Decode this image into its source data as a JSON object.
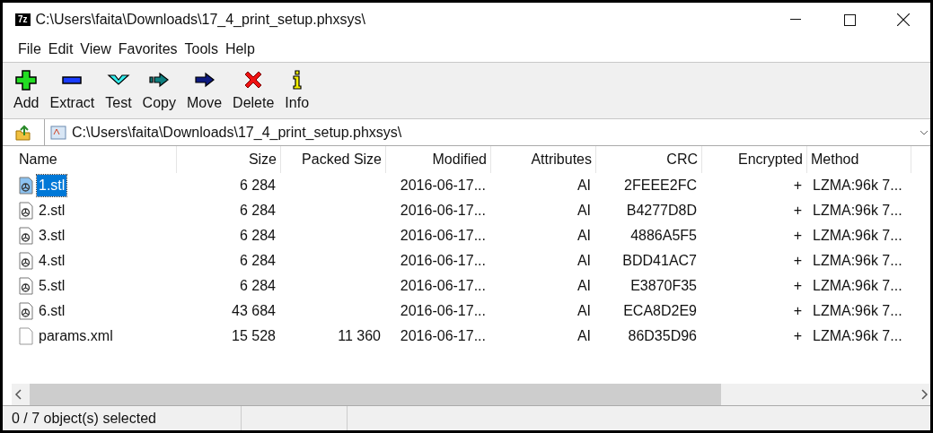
{
  "window": {
    "logo": "7z",
    "title": "C:\\Users\\faita\\Downloads\\17_4_print_setup.phxsys\\"
  },
  "menu": [
    "File",
    "Edit",
    "View",
    "Favorites",
    "Tools",
    "Help"
  ],
  "toolbar": [
    {
      "kind": "add",
      "label": "Add"
    },
    {
      "kind": "extract",
      "label": "Extract"
    },
    {
      "kind": "test",
      "label": "Test"
    },
    {
      "kind": "copy",
      "label": "Copy"
    },
    {
      "kind": "move",
      "label": "Move"
    },
    {
      "kind": "delete",
      "label": "Delete"
    },
    {
      "kind": "info",
      "label": "Info"
    }
  ],
  "address": {
    "value": "C:\\Users\\faita\\Downloads\\17_4_print_setup.phxsys\\"
  },
  "table": {
    "columns": [
      "Name",
      "Size",
      "Packed Size",
      "Modified",
      "Attributes",
      "CRC",
      "Encrypted",
      "Method"
    ],
    "rows": [
      {
        "kind": "stl",
        "selected": true,
        "cells": [
          "1.stl",
          "6 284",
          "",
          "2016-06-17...",
          "AI",
          "2FEEE2FC",
          "+",
          "LZMA:96k 7..."
        ]
      },
      {
        "kind": "stl",
        "selected": false,
        "cells": [
          "2.stl",
          "6 284",
          "",
          "2016-06-17...",
          "AI",
          "B4277D8D",
          "+",
          "LZMA:96k 7..."
        ]
      },
      {
        "kind": "stl",
        "selected": false,
        "cells": [
          "3.stl",
          "6 284",
          "",
          "2016-06-17...",
          "AI",
          "4886A5F5",
          "+",
          "LZMA:96k 7..."
        ]
      },
      {
        "kind": "stl",
        "selected": false,
        "cells": [
          "4.stl",
          "6 284",
          "",
          "2016-06-17...",
          "AI",
          "BDD41AC7",
          "+",
          "LZMA:96k 7..."
        ]
      },
      {
        "kind": "stl",
        "selected": false,
        "cells": [
          "5.stl",
          "6 284",
          "",
          "2016-06-17...",
          "AI",
          "E3870F35",
          "+",
          "LZMA:96k 7..."
        ]
      },
      {
        "kind": "stl",
        "selected": false,
        "cells": [
          "6.stl",
          "43 684",
          "",
          "2016-06-17...",
          "AI",
          "ECA8D2E9",
          "+",
          "LZMA:96k 7..."
        ]
      },
      {
        "kind": "file",
        "selected": false,
        "cells": [
          "params.xml",
          "15 528",
          "11 360",
          "2016-06-17...",
          "AI",
          "86D35D96",
          "+",
          "LZMA:96k 7..."
        ]
      }
    ]
  },
  "status_bar": "0 / 7 object(s) selected"
}
